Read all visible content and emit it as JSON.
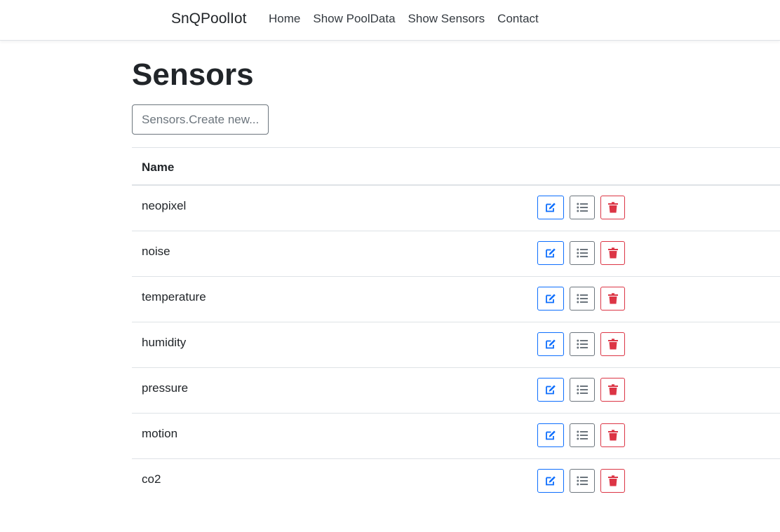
{
  "navbar": {
    "brand": "SnQPoolIot",
    "links": [
      "Home",
      "Show PoolData",
      "Show Sensors",
      "Contact"
    ]
  },
  "page": {
    "title": "Sensors",
    "create_button": "Sensors.Create new..."
  },
  "table": {
    "header": "Name",
    "rows": [
      {
        "name": "neopixel"
      },
      {
        "name": "noise"
      },
      {
        "name": "temperature"
      },
      {
        "name": "humidity"
      },
      {
        "name": "pressure"
      },
      {
        "name": "motion"
      },
      {
        "name": "co2"
      }
    ]
  },
  "icons": {
    "edit": "edit-icon",
    "details": "list-icon",
    "delete": "trash-icon"
  },
  "colors": {
    "primary": "#0d6efd",
    "secondary": "#6c757d",
    "danger": "#dc3545"
  }
}
